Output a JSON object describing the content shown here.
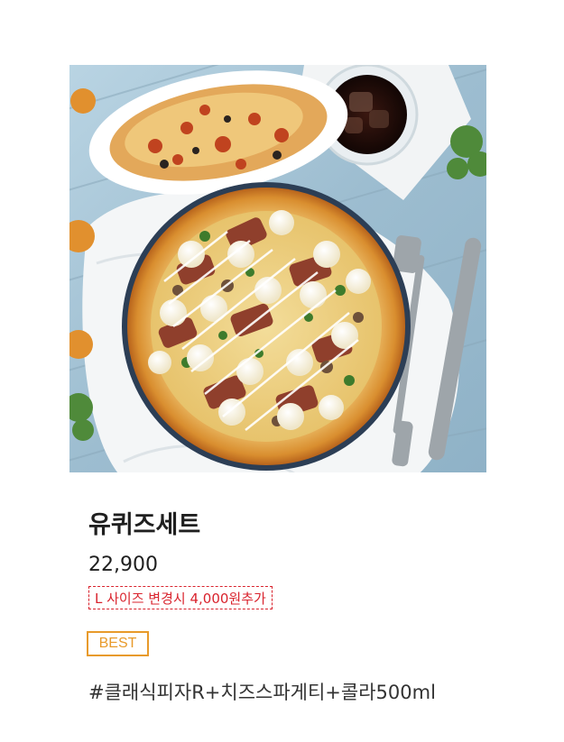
{
  "product": {
    "name": "유퀴즈세트",
    "price": "22,900",
    "size_notice": "L 사이즈 변경시 4,000원추가",
    "badge": "BEST",
    "tags": "#클래식피자R+치즈스파게티+콜라500ml",
    "image_icon": "pizza-set-photo",
    "zoom_icon": "magnifier-icon"
  },
  "colors": {
    "zoom_button": "#d61c2e",
    "size_notice": "#d9232d",
    "badge": "#e89a2a",
    "text": "#1f1f1f"
  }
}
